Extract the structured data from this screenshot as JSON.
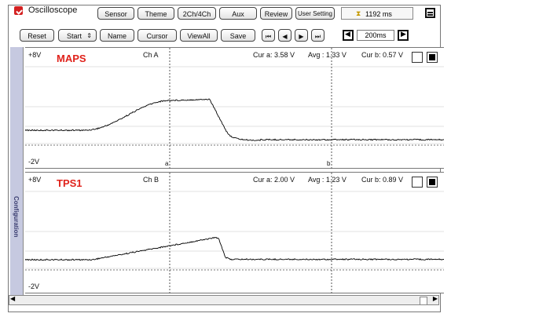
{
  "app": {
    "title": "Oscilloscope",
    "elapsed": "1192 ms"
  },
  "toolbar_top": [
    "Sensor",
    "Theme",
    "2Ch/4Ch",
    "Aux",
    "Review",
    "User Setting"
  ],
  "toolbar_second": {
    "reset": "Reset",
    "start": "Start",
    "name": "Name",
    "cursor": "Cursor",
    "view_all": "ViewAll",
    "save": "Save",
    "timebase": "200ms"
  },
  "sidebar": {
    "label": "Configuration"
  },
  "channels": [
    {
      "signal": "MAPS",
      "channel": "Ch A",
      "top_volt": "+8V",
      "bottom_volt": "-2V",
      "cur_a": "Cur a: 3.58 V",
      "avg": "Avg : 1.33 V",
      "cur_b": "Cur b: 0.57 V",
      "trace_color": "#000000"
    },
    {
      "signal": "TPS1",
      "channel": "Ch B",
      "top_volt": "+8V",
      "bottom_volt": "-2V",
      "cur_a": "Cur a: 2.00 V",
      "avg": "Avg : 1.23 V",
      "cur_b": "Cur b: 0.89 V",
      "trace_color": "#000000"
    }
  ],
  "cursors": {
    "a_label": "a",
    "b_label": "b"
  },
  "colors": {
    "signal_label": "#e0221b",
    "sidebar": "#c6c9e0"
  }
}
